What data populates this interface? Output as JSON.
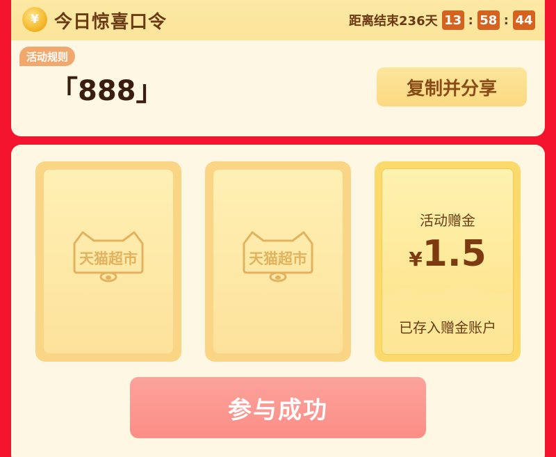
{
  "header": {
    "coin_symbol": "¥",
    "title": "今日惊喜口令",
    "countdown_label": "距离结束236天",
    "hours": "13",
    "minutes": "58",
    "seconds": "44",
    "separator": ":"
  },
  "rules": {
    "tag_label": "活动规则",
    "code": "「888」",
    "copy_button": "复制并分享"
  },
  "cards": [
    {
      "logo_text": "天猫超市"
    },
    {
      "logo_text": "天猫超市"
    }
  ],
  "bonus": {
    "title": "活动赠金",
    "currency": "¥",
    "amount": "1.5",
    "note": "已存入赠金账户"
  },
  "action": {
    "join_button": "参与成功"
  },
  "colors": {
    "page_bg": "#f5142d",
    "card_bg": "#fdf7e4",
    "accent_orange": "#d5621e",
    "button_pink": "#fb8e86"
  }
}
